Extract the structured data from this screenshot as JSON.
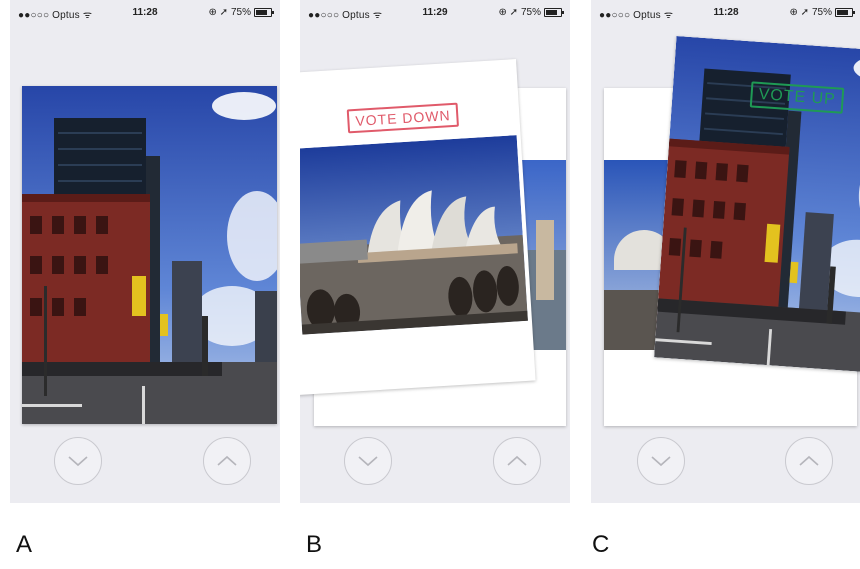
{
  "panels": [
    {
      "label": "A",
      "status": {
        "carrier": "●●○○○ Optus ᯤ",
        "time": "11:28",
        "battery": "75%",
        "battery_level": 0.75
      }
    },
    {
      "label": "B",
      "status": {
        "carrier": "●●○○○ Optus ᯤ",
        "time": "11:29",
        "battery": "75%",
        "battery_level": 0.75
      },
      "stamp": "VOTE DOWN"
    },
    {
      "label": "C",
      "status": {
        "carrier": "●●○○○ Optus ᯤ",
        "time": "11:28",
        "battery": "75%",
        "battery_level": 0.75
      },
      "stamp": "VOTE UP"
    }
  ],
  "colors": {
    "background": "#ececf1",
    "vote_down_stamp": "#e05a6a",
    "vote_up_stamp": "#1f9a55",
    "button_border": "#c9c9cf",
    "icon": "#b5b5bb"
  },
  "icons": {
    "down_button": "chevron-down-icon",
    "up_button": "chevron-up-icon"
  }
}
